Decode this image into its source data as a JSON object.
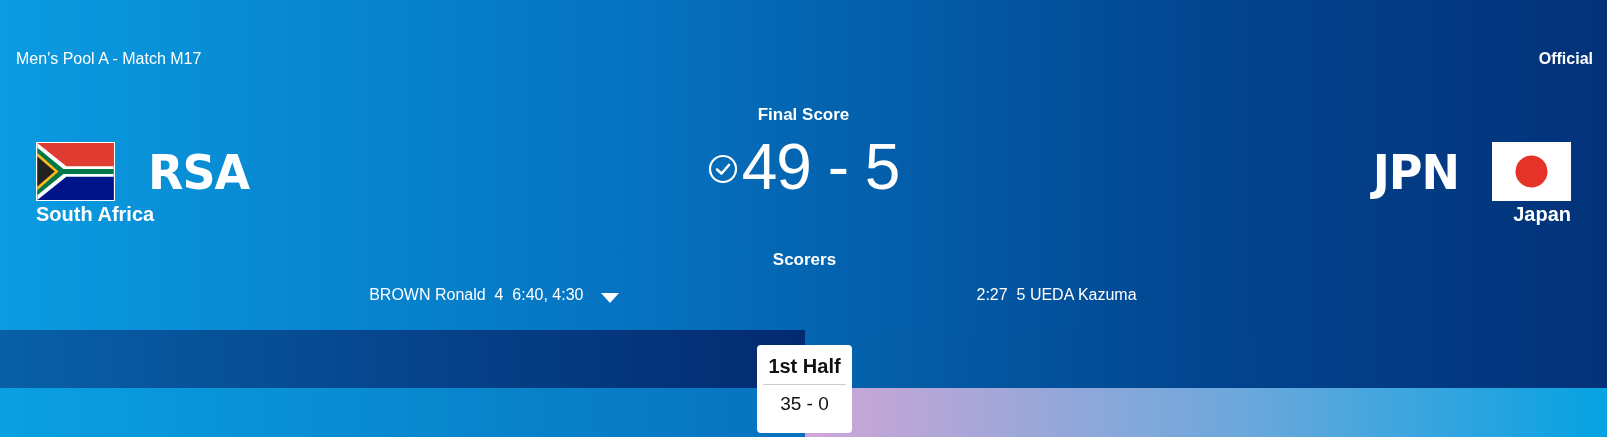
{
  "match_title": "Men's Pool A - Match M17",
  "status": "Official",
  "final_label": "Final Score",
  "score": "49 - 5",
  "home": {
    "code": "RSA",
    "name": "South Africa"
  },
  "away": {
    "code": "JPN",
    "name": "Japan"
  },
  "scorers_label": "Scorers",
  "home_scorers": [
    "BROWN Ronald  4  6:40, 4:30"
  ],
  "away_scorers": [
    "2:27  5 UEDA Kazuma"
  ],
  "periods": [
    {
      "label": "1st Half",
      "score": "35 - 0"
    }
  ]
}
